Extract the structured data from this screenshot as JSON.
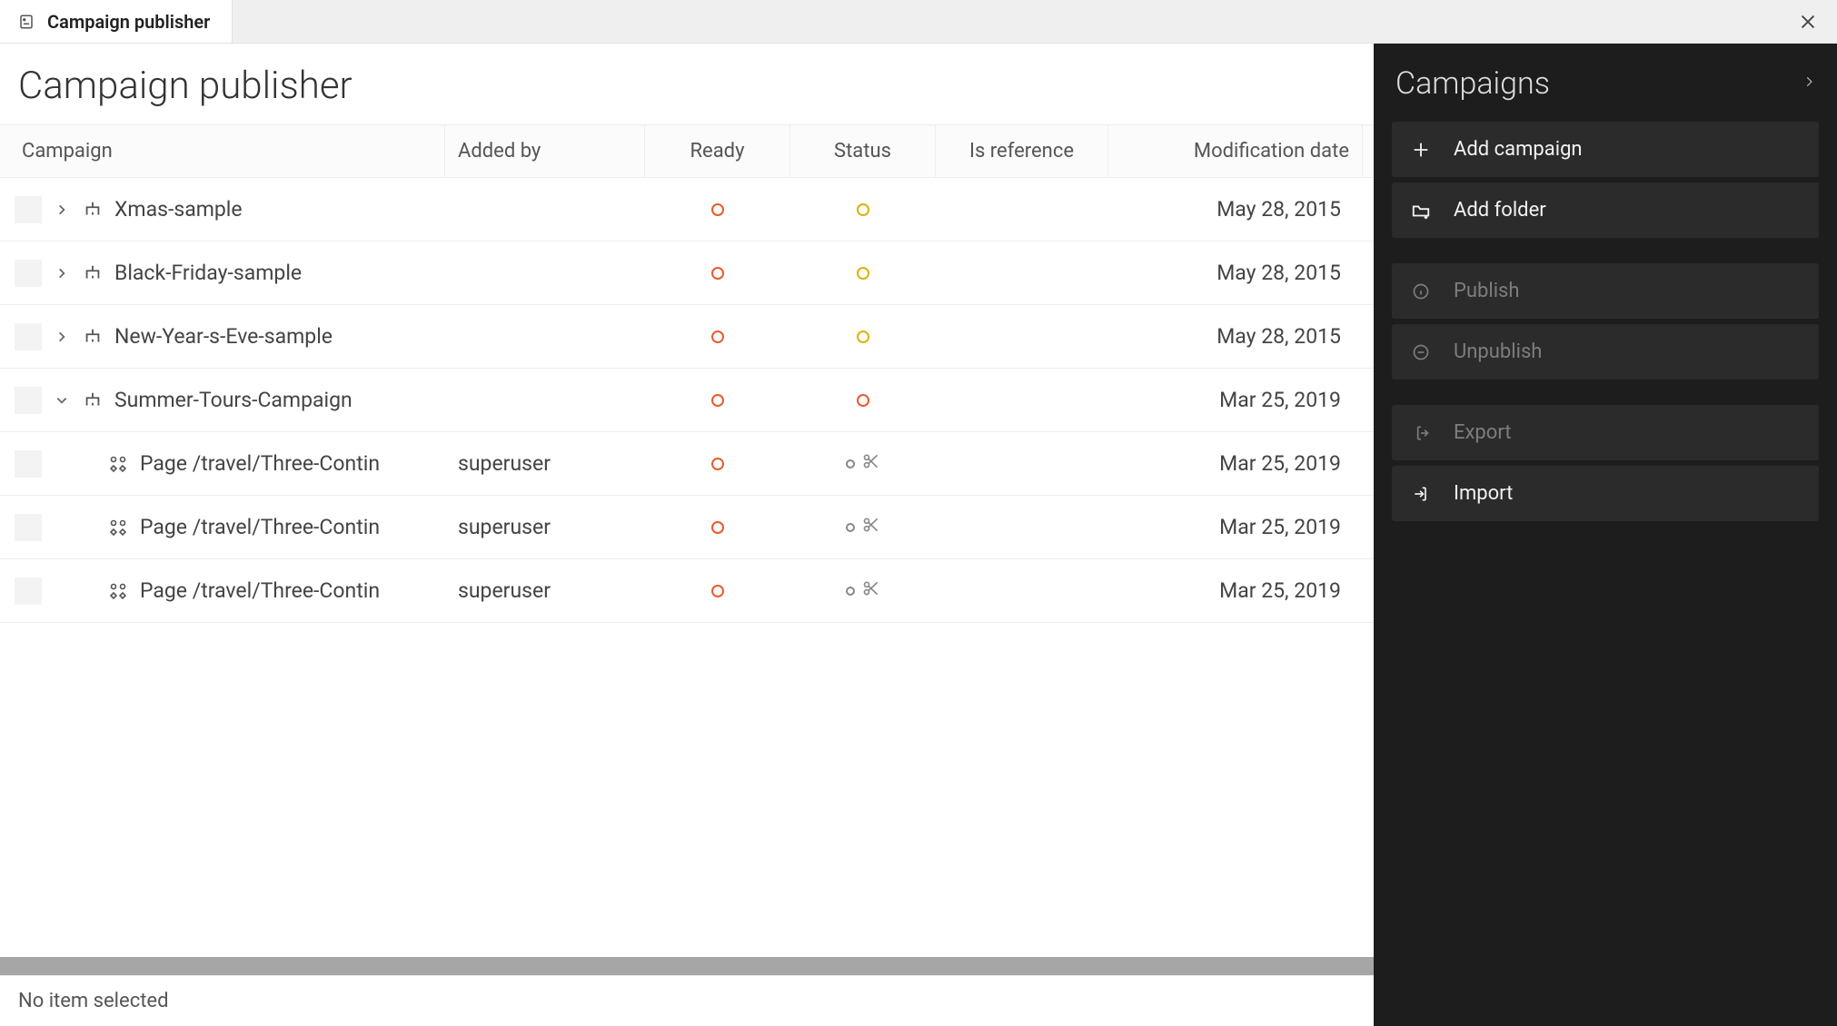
{
  "tab": {
    "title": "Campaign publisher"
  },
  "page": {
    "title": "Campaign publisher"
  },
  "columns": {
    "campaign": "Campaign",
    "added_by": "Added by",
    "ready": "Ready",
    "status": "Status",
    "is_reference": "Is reference",
    "modification_date": "Modification date"
  },
  "rows": [
    {
      "type": "campaign",
      "expanded": false,
      "name": "Xmas-sample",
      "added_by": "",
      "status_color": "yellow",
      "has_scissors": false,
      "modification_date": "May 28, 2015"
    },
    {
      "type": "campaign",
      "expanded": false,
      "name": "Black-Friday-sample",
      "added_by": "",
      "status_color": "yellow",
      "has_scissors": false,
      "modification_date": "May 28, 2015"
    },
    {
      "type": "campaign",
      "expanded": false,
      "name": "New-Year-s-Eve-sample",
      "added_by": "",
      "status_color": "yellow",
      "has_scissors": false,
      "modification_date": "May 28, 2015"
    },
    {
      "type": "campaign",
      "expanded": true,
      "name": "Summer-Tours-Campaign",
      "added_by": "",
      "status_color": "orange",
      "has_scissors": false,
      "modification_date": "Mar 25, 2019"
    },
    {
      "type": "page",
      "name": "Page /travel/Three-Contin",
      "added_by": "superuser",
      "status_color": "gray",
      "has_scissors": true,
      "modification_date": "Mar 25, 2019"
    },
    {
      "type": "page",
      "name": "Page /travel/Three-Contin",
      "added_by": "superuser",
      "status_color": "gray",
      "has_scissors": true,
      "modification_date": "Mar 25, 2019"
    },
    {
      "type": "page",
      "name": "Page /travel/Three-Contin",
      "added_by": "superuser",
      "status_color": "gray",
      "has_scissors": true,
      "modification_date": "Mar 25, 2019"
    }
  ],
  "footer": {
    "status": "No item selected"
  },
  "sidepanel": {
    "title": "Campaigns",
    "actions": {
      "add_campaign": "Add campaign",
      "add_folder": "Add folder",
      "publish": "Publish",
      "unpublish": "Unpublish",
      "export": "Export",
      "import": "Import"
    }
  }
}
